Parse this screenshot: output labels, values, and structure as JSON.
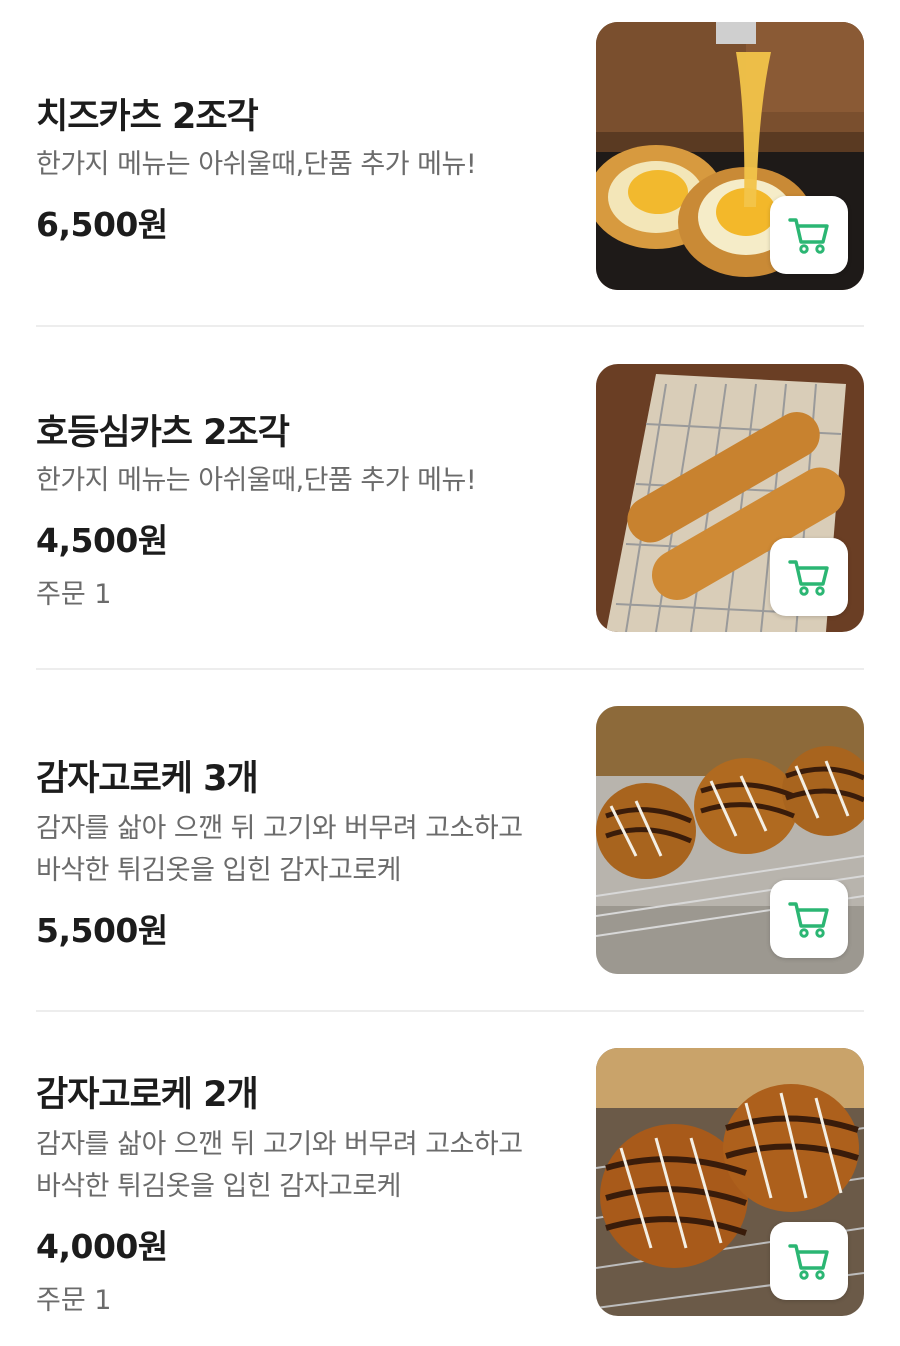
{
  "accent_color": "#2bb673",
  "cart_icon": "cart-icon",
  "items": [
    {
      "name": "치즈카츠 2조각",
      "description": "한가지 메뉴는 아쉬울때,단품 추가 메뉴!",
      "price": "6,500원",
      "order": ""
    },
    {
      "name": "호등심카츠 2조각",
      "description": "한가지 메뉴는 아쉬울때,단품 추가 메뉴!",
      "price": "4,500원",
      "order": "주문 1"
    },
    {
      "name": "감자고로케 3개",
      "description": "감자를 삶아 으깬 뒤 고기와 버무려 고소하고 바삭한 튀김옷을 입힌 감자고로케",
      "price": "5,500원",
      "order": ""
    },
    {
      "name": "감자고로케 2개",
      "description": "감자를 삶아 으깬 뒤 고기와 버무려 고소하고 바삭한 튀김옷을 입힌 감자고로케",
      "price": "4,000원",
      "order": "주문 1"
    }
  ]
}
